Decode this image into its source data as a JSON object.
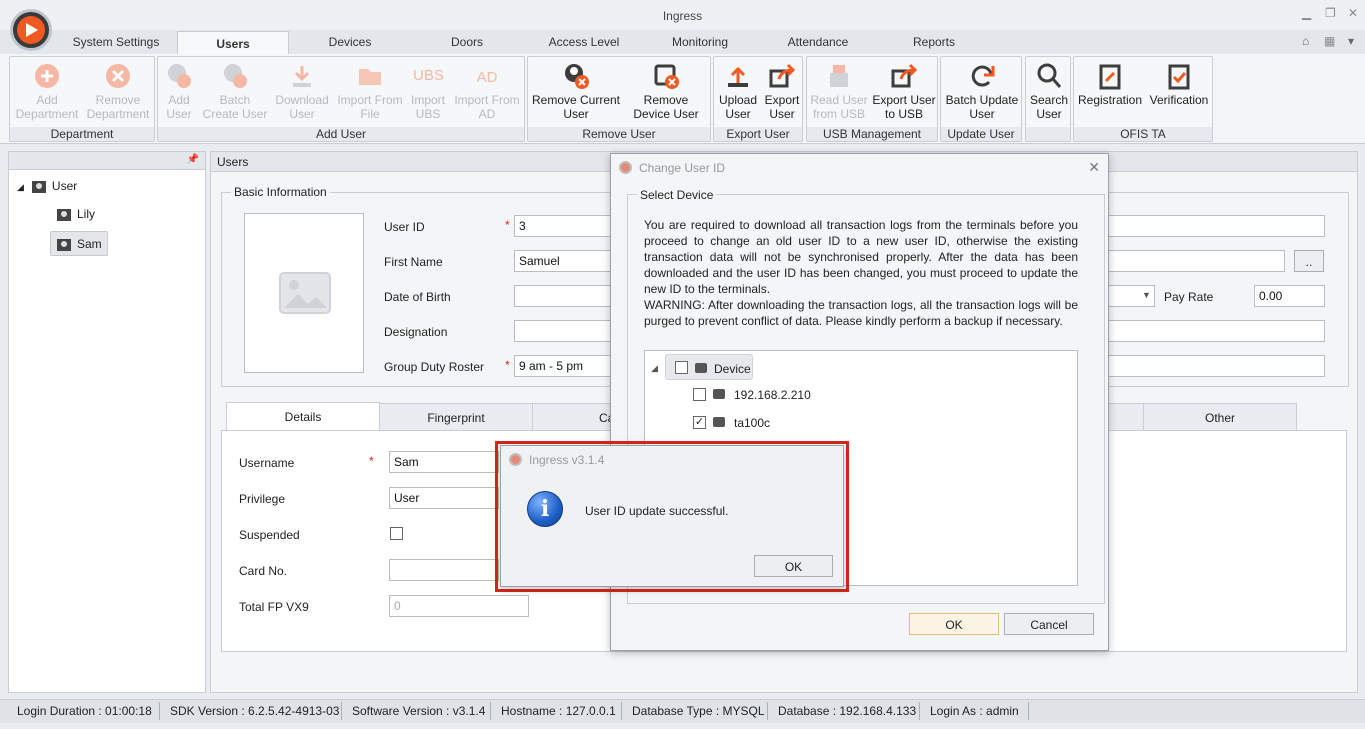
{
  "window": {
    "title": "Ingress"
  },
  "ribbon_tabs": [
    "System Settings",
    "Users",
    "Devices",
    "Doors",
    "Access Level",
    "Monitoring",
    "Attendance",
    "Reports"
  ],
  "ribbon": {
    "department": {
      "label": "Department",
      "buttons": [
        "Add Department",
        "Remove Department"
      ]
    },
    "add_user": {
      "label": "Add User",
      "buttons": [
        "Add User",
        "Batch Create User",
        "Download User",
        "Import From File",
        "Import UBS",
        "Import From AD"
      ]
    },
    "remove_user": {
      "label": "Remove User",
      "buttons": [
        "Remove Current User",
        "Remove Device User"
      ]
    },
    "export_user": {
      "label": "Export User",
      "buttons": [
        "Upload User",
        "Export User"
      ]
    },
    "usb": {
      "label": "USB Management",
      "buttons": [
        "Read User from USB",
        "Export User to USB"
      ]
    },
    "update_user": {
      "label": "Update User",
      "buttons": [
        "Batch Update User"
      ]
    },
    "search": {
      "buttons": [
        "Search User"
      ]
    },
    "ofis": {
      "label": "OFIS TA",
      "buttons": [
        "Registration",
        "Verification"
      ]
    },
    "ubs_text": "UBS",
    "ad_text": "AD"
  },
  "tree": {
    "root": "User",
    "children": [
      "Lily",
      "Sam"
    ]
  },
  "main": {
    "header": "Users",
    "basic_info": "Basic Information",
    "fields": {
      "user_id_label": "User ID",
      "user_id": "3",
      "first_name_label": "First Name",
      "first_name": "Samuel",
      "dob_label": "Date of Birth",
      "dob": "",
      "designation_label": "Designation",
      "designation": "",
      "roster_label": "Group Duty Roster",
      "roster": "9 am - 5 pm",
      "pay_rate_label": "Pay Rate",
      "pay_rate": "0.00",
      "browse_btn": ".."
    },
    "tabs": [
      "Details",
      "Fingerprint",
      "Ca",
      "Other"
    ],
    "details": {
      "username_label": "Username",
      "username": "Sam",
      "privilege_label": "Privilege",
      "privilege": "User",
      "suspended_label": "Suspended",
      "card_label": "Card No.",
      "card": "",
      "fp_label": "Total FP VX9",
      "fp_placeholder": "0"
    }
  },
  "change_dialog": {
    "title": "Change User ID",
    "group": "Select Device",
    "message": "You are required to download all transaction logs from the terminals before you proceed to change an old user ID to a new user ID, otherwise the existing transaction data will not be synchronised properly. After the data has been downloaded and the user ID has been changed, you must proceed to update the new ID to the terminals.",
    "warning": "WARNING: After downloading the transaction logs, all the transaction logs will be purged to prevent conflict of data. Please kindly perform a backup if necessary.",
    "tree_root": "Device",
    "devices": [
      {
        "name": "192.168.2.210",
        "checked": false
      },
      {
        "name": "ta100c",
        "checked": true
      }
    ],
    "ok": "OK",
    "cancel": "Cancel"
  },
  "message_box": {
    "title": "Ingress v3.1.4",
    "text": "User ID update successful.",
    "ok": "OK"
  },
  "status": {
    "login_duration": "Login Duration : 01:00:18",
    "sdk": "SDK Version : 6.2.5.42-4913-03",
    "software": "Software Version : v3.1.4",
    "hostname": "Hostname : 127.0.0.1",
    "db_type": "Database Type : MYSQL",
    "database": "Database : 192.168.4.133",
    "login_as": "Login As : admin"
  },
  "colors": {
    "accent": "#f05a22",
    "highlight_border": "#d9261c",
    "info_blue": "#1d5fc6"
  }
}
